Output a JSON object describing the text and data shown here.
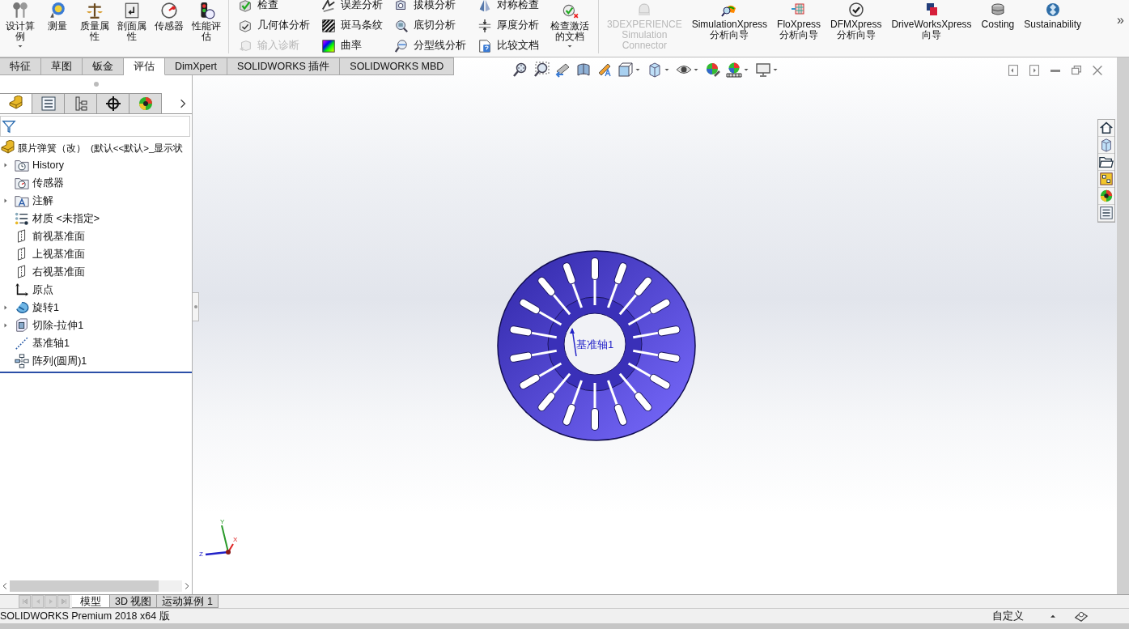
{
  "ribbon": {
    "large_tools": [
      {
        "label": "设计算例",
        "menu": true,
        "disabled": false
      },
      {
        "label": "测量",
        "menu": false,
        "disabled": false
      },
      {
        "label": "质量属性",
        "menu": false,
        "disabled": false
      },
      {
        "label": "剖面属性",
        "menu": false,
        "disabled": false
      },
      {
        "label": "传感器",
        "menu": false,
        "disabled": false
      },
      {
        "label": "性能评估",
        "menu": false,
        "disabled": false
      }
    ],
    "tool_columns": [
      [
        {
          "label": "检查",
          "disabled": false
        },
        {
          "label": "几何体分析",
          "disabled": false
        },
        {
          "label": "输入诊断",
          "disabled": true
        }
      ],
      [
        {
          "label": "误差分析",
          "disabled": false
        },
        {
          "label": "斑马条纹",
          "disabled": false
        },
        {
          "label": "曲率",
          "disabled": false
        }
      ],
      [
        {
          "label": "拔模分析",
          "disabled": false
        },
        {
          "label": "底切分析",
          "disabled": false
        },
        {
          "label": "分型线分析",
          "disabled": false
        }
      ],
      [
        {
          "label": "对称检查",
          "disabled": false
        },
        {
          "label": "厚度分析",
          "disabled": false
        },
        {
          "label": "比较文档",
          "disabled": false
        }
      ]
    ],
    "check_active": {
      "label": "检查激活的文档",
      "menu": true
    },
    "addins": [
      {
        "label": "3DEXPERIENCE Simulation Connector",
        "disabled": true
      },
      {
        "label": "SimulationXpress 分析向导",
        "disabled": false
      },
      {
        "label": "FloXpress 分析向导",
        "disabled": false
      },
      {
        "label": "DFMXpress 分析向导",
        "disabled": false
      },
      {
        "label": "DriveWorksXpress 向导",
        "disabled": false
      },
      {
        "label": "Costing",
        "disabled": false
      },
      {
        "label": "Sustainability",
        "disabled": false
      }
    ],
    "overflow": "»"
  },
  "ribbon_tabs": [
    {
      "label": "特征",
      "selected": false
    },
    {
      "label": "草图",
      "selected": false
    },
    {
      "label": "钣金",
      "selected": false
    },
    {
      "label": "评估",
      "selected": true
    },
    {
      "label": "DimXpert",
      "selected": false
    },
    {
      "label": "SOLIDWORKS 插件",
      "selected": false
    },
    {
      "label": "SOLIDWORKS MBD",
      "selected": false
    }
  ],
  "heads_up_toolbar": [
    {
      "menu": false
    },
    {
      "menu": false
    },
    {
      "menu": false
    },
    {
      "menu": false
    },
    {
      "menu": false
    },
    {
      "menu": true
    },
    {
      "menu": true
    },
    {
      "menu": true
    },
    {
      "menu": false
    },
    {
      "menu": true
    },
    {
      "menu": true
    }
  ],
  "feature_manager": {
    "panel_tabs": [
      {
        "selected": true
      },
      {
        "selected": false
      },
      {
        "selected": false
      },
      {
        "selected": false
      },
      {
        "selected": false
      }
    ],
    "tree": {
      "name": "膜片弹簧（改）",
      "configuration": "(默认<<默认>_显示状",
      "children": [
        {
          "label": "History",
          "expandable": true
        },
        {
          "label": "传感器",
          "expandable": false
        },
        {
          "label": "注解",
          "expandable": true
        },
        {
          "label": "材质 <未指定>",
          "expandable": false
        },
        {
          "label": "前视基准面",
          "expandable": false
        },
        {
          "label": "上视基准面",
          "expandable": false
        },
        {
          "label": "右视基准面",
          "expandable": false
        },
        {
          "label": "原点",
          "expandable": false
        },
        {
          "label": "旋转1",
          "expandable": true
        },
        {
          "label": "切除-拉伸1",
          "expandable": true
        },
        {
          "label": "基准轴1",
          "expandable": false
        },
        {
          "label": "阵列(圆周)1",
          "expandable": false
        }
      ]
    }
  },
  "viewport": {
    "axis_label": "基准轴1",
    "triad": [
      "Y",
      "X",
      "Z"
    ]
  },
  "model_tabs": [
    {
      "label": "模型",
      "selected": true
    },
    {
      "label": "3D 视图",
      "selected": false
    },
    {
      "label": "运动算例 1",
      "selected": false
    }
  ],
  "status_bar": {
    "product": "SOLIDWORKS Premium 2018 x64 版",
    "units": "自定义"
  }
}
